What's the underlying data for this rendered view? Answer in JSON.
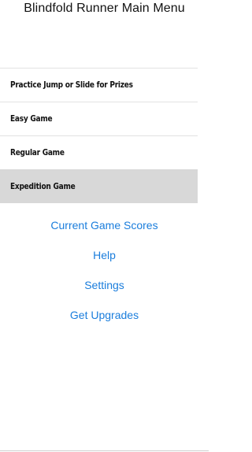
{
  "header": {
    "title": "Blindfold Runner Main Menu"
  },
  "menu": {
    "items": [
      {
        "label": "Practice Jump or Slide for Prizes",
        "selected": false
      },
      {
        "label": "Easy Game",
        "selected": false
      },
      {
        "label": "Regular Game",
        "selected": false
      },
      {
        "label": "Expedition Game",
        "selected": true
      }
    ]
  },
  "links": {
    "scores": "Current Game Scores",
    "help": "Help",
    "settings": "Settings",
    "upgrades": "Get Upgrades"
  },
  "colors": {
    "link": "#1a7ddc",
    "selected_row": "#d8d8d8",
    "divider": "#e2e2e2"
  }
}
